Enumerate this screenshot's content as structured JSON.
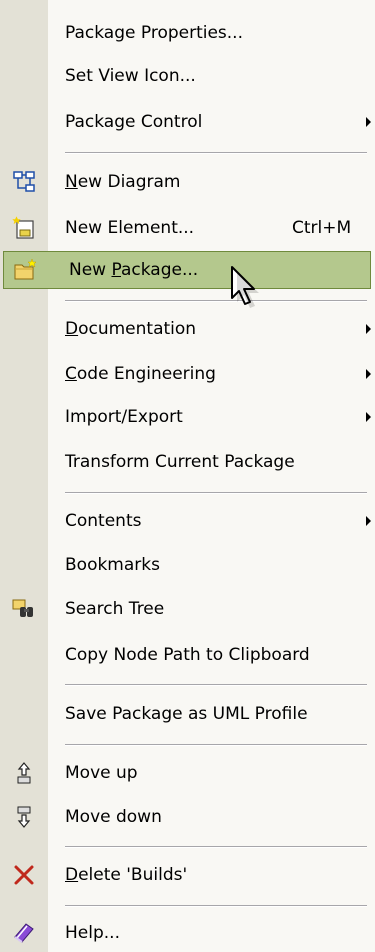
{
  "menu": {
    "items": [
      {
        "label": "Package Properties...",
        "ul": -1
      },
      {
        "label": "Set View Icon...",
        "ul": -1
      },
      {
        "label": "Package Control",
        "ul": -1,
        "submenu": true
      },
      {
        "label": "New Diagram",
        "ul": 0,
        "icon": "new-diagram-icon"
      },
      {
        "label": "New Element...",
        "ul": -1,
        "icon": "new-element-icon",
        "shortcut": "Ctrl+M"
      },
      {
        "label": "New Package...",
        "ul": 4,
        "icon": "new-package-icon",
        "highlighted": true
      },
      {
        "label": "Documentation",
        "ul": 0,
        "submenu": true
      },
      {
        "label": "Code Engineering",
        "ul": 0,
        "submenu": true
      },
      {
        "label": "Import/Export",
        "ul": -1,
        "submenu": true
      },
      {
        "label": "Transform Current Package",
        "ul": -1
      },
      {
        "label": "Contents",
        "ul": -1,
        "submenu": true
      },
      {
        "label": "Bookmarks",
        "ul": -1
      },
      {
        "label": "Search Tree",
        "ul": -1,
        "icon": "binoculars-icon"
      },
      {
        "label": "Copy Node Path to Clipboard",
        "ul": -1
      },
      {
        "label": "Save Package as UML Profile",
        "ul": -1
      },
      {
        "label": "Move up",
        "ul": -1,
        "icon": "move-up-icon"
      },
      {
        "label": "Move down",
        "ul": -1,
        "icon": "move-down-icon"
      },
      {
        "label": "Delete 'Builds'",
        "ul": 0,
        "icon": "delete-icon"
      },
      {
        "label": "Help...",
        "ul": -1,
        "icon": "help-book-icon"
      }
    ]
  },
  "colors": {
    "highlight": "#b4c88d",
    "gutter": "#e3e1d6",
    "background": "#f9f8f4"
  }
}
